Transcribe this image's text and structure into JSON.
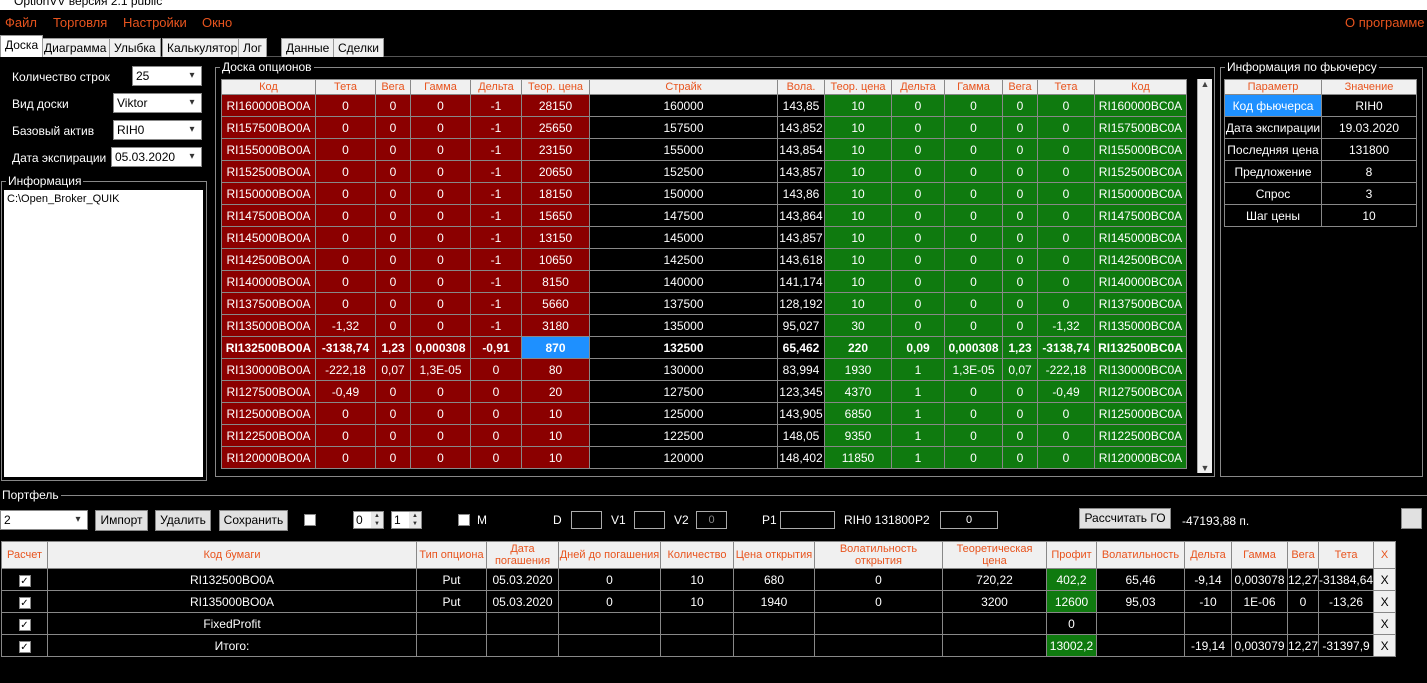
{
  "window": {
    "title": "OptionVV версия 2.1 public"
  },
  "menu": [
    "Файл",
    "Торговля",
    "Настройки",
    "Окно"
  ],
  "menu_right": "О программе",
  "tabs": [
    "Доска",
    "Диаграмма",
    "Улыбка",
    "Калькулятор",
    "Лог",
    "Данные",
    "Сделки"
  ],
  "left": {
    "rows_label": "Количество строк",
    "rows_value": "25",
    "view_label": "Вид доски",
    "view_value": "Viktor",
    "asset_label": "Базовый актив",
    "asset_value": "RIH0",
    "exp_label": "Дата экспирации",
    "exp_value": "05.03.2020",
    "info_title": "Информация",
    "info_text": "C:\\Open_Broker_QUIK"
  },
  "board": {
    "title": "Доска опционов",
    "headers": [
      "Код",
      "Тета",
      "Вега",
      "Гамма",
      "Дельта",
      "Теор. цена",
      "Страйк",
      "Вола.",
      "Теор. цена",
      "Дельта",
      "Гамма",
      "Вега",
      "Тета",
      "Код"
    ],
    "rows": [
      [
        "RI160000BO0A",
        "0",
        "0",
        "0",
        "-1",
        "28150",
        "160000",
        "143,85",
        "10",
        "0",
        "0",
        "0",
        "0",
        "RI160000BC0A"
      ],
      [
        "RI157500BO0A",
        "0",
        "0",
        "0",
        "-1",
        "25650",
        "157500",
        "143,852",
        "10",
        "0",
        "0",
        "0",
        "0",
        "RI157500BC0A"
      ],
      [
        "RI155000BO0A",
        "0",
        "0",
        "0",
        "-1",
        "23150",
        "155000",
        "143,854",
        "10",
        "0",
        "0",
        "0",
        "0",
        "RI155000BC0A"
      ],
      [
        "RI152500BO0A",
        "0",
        "0",
        "0",
        "-1",
        "20650",
        "152500",
        "143,857",
        "10",
        "0",
        "0",
        "0",
        "0",
        "RI152500BC0A"
      ],
      [
        "RI150000BO0A",
        "0",
        "0",
        "0",
        "-1",
        "18150",
        "150000",
        "143,86",
        "10",
        "0",
        "0",
        "0",
        "0",
        "RI150000BC0A"
      ],
      [
        "RI147500BO0A",
        "0",
        "0",
        "0",
        "-1",
        "15650",
        "147500",
        "143,864",
        "10",
        "0",
        "0",
        "0",
        "0",
        "RI147500BC0A"
      ],
      [
        "RI145000BO0A",
        "0",
        "0",
        "0",
        "-1",
        "13150",
        "145000",
        "143,857",
        "10",
        "0",
        "0",
        "0",
        "0",
        "RI145000BC0A"
      ],
      [
        "RI142500BO0A",
        "0",
        "0",
        "0",
        "-1",
        "10650",
        "142500",
        "143,618",
        "10",
        "0",
        "0",
        "0",
        "0",
        "RI142500BC0A"
      ],
      [
        "RI140000BO0A",
        "0",
        "0",
        "0",
        "-1",
        "8150",
        "140000",
        "141,174",
        "10",
        "0",
        "0",
        "0",
        "0",
        "RI140000BC0A"
      ],
      [
        "RI137500BO0A",
        "0",
        "0",
        "0",
        "-1",
        "5660",
        "137500",
        "128,192",
        "10",
        "0",
        "0",
        "0",
        "0",
        "RI137500BC0A"
      ],
      [
        "RI135000BO0A",
        "-1,32",
        "0",
        "0",
        "-1",
        "3180",
        "135000",
        "95,027",
        "30",
        "0",
        "0",
        "0",
        "-1,32",
        "RI135000BC0A"
      ],
      [
        "RI132500BO0A",
        "-3138,74",
        "1,23",
        "0,000308",
        "-0,91",
        "870",
        "132500",
        "65,462",
        "220",
        "0,09",
        "0,000308",
        "1,23",
        "-3138,74",
        "RI132500BC0A"
      ],
      [
        "RI130000BO0A",
        "-222,18",
        "0,07",
        "1,3E-05",
        "0",
        "80",
        "130000",
        "83,994",
        "1930",
        "1",
        "1,3E-05",
        "0,07",
        "-222,18",
        "RI130000BC0A"
      ],
      [
        "RI127500BO0A",
        "-0,49",
        "0",
        "0",
        "0",
        "20",
        "127500",
        "123,345",
        "4370",
        "1",
        "0",
        "0",
        "-0,49",
        "RI127500BC0A"
      ],
      [
        "RI125000BO0A",
        "0",
        "0",
        "0",
        "0",
        "10",
        "125000",
        "143,905",
        "6850",
        "1",
        "0",
        "0",
        "0",
        "RI125000BC0A"
      ],
      [
        "RI122500BO0A",
        "0",
        "0",
        "0",
        "0",
        "10",
        "122500",
        "148,05",
        "9350",
        "1",
        "0",
        "0",
        "0",
        "RI122500BC0A"
      ],
      [
        "RI120000BO0A",
        "0",
        "0",
        "0",
        "0",
        "10",
        "120000",
        "148,402",
        "11850",
        "1",
        "0",
        "0",
        "0",
        "RI120000BC0A"
      ]
    ]
  },
  "futures": {
    "title": "Информация по фьючерсу",
    "headers": [
      "Параметр",
      "Значение"
    ],
    "rows": [
      [
        "Код фьючерса",
        "RIH0"
      ],
      [
        "Дата экспирации",
        "19.03.2020"
      ],
      [
        "Последняя цена",
        "131800"
      ],
      [
        "Предложение",
        "8"
      ],
      [
        "Спрос",
        "3"
      ],
      [
        "Шаг цены",
        "10"
      ]
    ]
  },
  "portfolio": {
    "title": "Портфель",
    "select_value": "2",
    "import": "Импорт",
    "delete": "Удалить",
    "save": "Сохранить",
    "m_label": "M",
    "spin1": "0",
    "spin2": "1",
    "d_label": "D",
    "v1_label": "V1",
    "v2_label": "V2",
    "v2_value": "0",
    "p1_label": "P1",
    "fut_price": "RIH0 131800",
    "p2_label": "P2",
    "p2_value": "0",
    "calc_go": "Рассчитать ГО",
    "go_value": "-47193,88 п.",
    "headers": [
      "Расчет",
      "Код бумаги",
      "Тип опциона",
      "Дата погашения",
      "Дней до погашения",
      "Количество",
      "Цена открытия",
      "Волатильность открытия",
      "Теоретическая цена",
      "Профит",
      "Волатильность",
      "Дельта",
      "Гамма",
      "Вега",
      "Тета",
      "X"
    ],
    "rows": [
      [
        "✓",
        "RI132500BO0A",
        "Put",
        "05.03.2020",
        "0",
        "10",
        "680",
        "0",
        "720,22",
        "402,2",
        "65,46",
        "-9,14",
        "0,003078",
        "12,27",
        "-31384,64",
        "X"
      ],
      [
        "✓",
        "RI135000BO0A",
        "Put",
        "05.03.2020",
        "0",
        "10",
        "1940",
        "0",
        "3200",
        "12600",
        "95,03",
        "-10",
        "1E-06",
        "0",
        "-13,26",
        "X"
      ],
      [
        "✓",
        "FixedProfit",
        "",
        "",
        "",
        "",
        "",
        "",
        "",
        "0",
        "",
        "",
        "",
        "",
        "",
        "X"
      ],
      [
        "✓",
        "Итого:",
        "",
        "",
        "",
        "",
        "",
        "",
        "",
        "13002,2",
        "",
        "-19,14",
        "0,003079",
        "12,27",
        "-31397,9",
        "X"
      ]
    ]
  }
}
